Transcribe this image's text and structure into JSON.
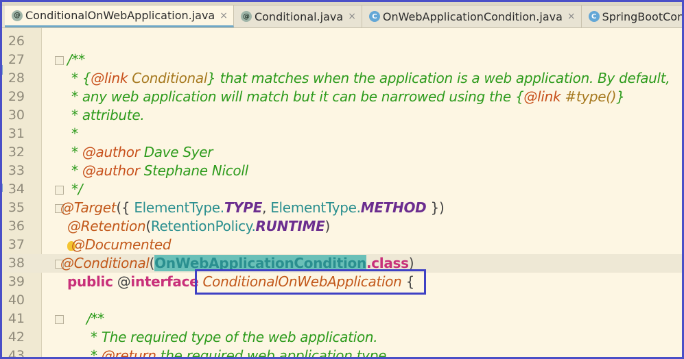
{
  "tabs": [
    {
      "label": "ConditionalOnWebApplication.java",
      "icon": "annotation-icon",
      "glyph": "@",
      "active": true
    },
    {
      "label": "Conditional.java",
      "icon": "annotation-icon",
      "glyph": "@",
      "active": false
    },
    {
      "label": "OnWebApplicationCondition.java",
      "icon": "class-icon",
      "glyph": "C",
      "active": false
    },
    {
      "label": "SpringBootCondition.jav",
      "icon": "class-icon",
      "glyph": "C",
      "active": false
    }
  ],
  "close_glyph": "×",
  "lines": [
    {
      "n": "26",
      "tokens": []
    },
    {
      "n": "27",
      "tokens": [
        [
          "c-comment",
          "/**"
        ]
      ],
      "indent": 98,
      "fold": true
    },
    {
      "n": "28",
      "tokens": [
        [
          "c-comment",
          " * {"
        ],
        [
          "c-tag",
          "@link"
        ],
        [
          "c-comment",
          " "
        ],
        [
          "c-link",
          "Conditional"
        ],
        [
          "c-comment",
          "} that matches when the application is a web application. By default,"
        ]
      ],
      "indent": 98
    },
    {
      "n": "29",
      "tokens": [
        [
          "c-comment",
          " * any web application will match but it can be narrowed using the {"
        ],
        [
          "c-tag",
          "@link"
        ],
        [
          "c-comment",
          " "
        ],
        [
          "c-link",
          "#type()"
        ],
        [
          "c-comment",
          "}"
        ]
      ],
      "indent": 98
    },
    {
      "n": "30",
      "tokens": [
        [
          "c-comment",
          " * attribute."
        ]
      ],
      "indent": 98
    },
    {
      "n": "31",
      "tokens": [
        [
          "c-comment",
          " *"
        ]
      ],
      "indent": 98
    },
    {
      "n": "32",
      "tokens": [
        [
          "c-comment",
          " * "
        ],
        [
          "c-tag",
          "@author"
        ],
        [
          "c-comment",
          " Dave Syer"
        ]
      ],
      "indent": 98
    },
    {
      "n": "33",
      "tokens": [
        [
          "c-comment",
          " * "
        ],
        [
          "c-tag",
          "@author"
        ],
        [
          "c-comment",
          " Stephane Nicoll"
        ]
      ],
      "indent": 98
    },
    {
      "n": "34",
      "tokens": [
        [
          "c-comment",
          " */"
        ]
      ],
      "indent": 98,
      "fold": true
    },
    {
      "n": "35",
      "tokens": [
        [
          "c-annot",
          "@Target"
        ],
        [
          "c-plain",
          "({ "
        ],
        [
          "c-type",
          "ElementType."
        ],
        [
          "c-const",
          "TYPE"
        ],
        [
          "c-plain",
          ", "
        ],
        [
          "c-type",
          "ElementType."
        ],
        [
          "c-const",
          "METHOD"
        ],
        [
          "c-plain",
          " })"
        ]
      ],
      "indent": 88,
      "fold": true
    },
    {
      "n": "36",
      "tokens": [
        [
          "c-annot",
          "@Retention"
        ],
        [
          "c-plain",
          "("
        ],
        [
          "c-type",
          "RetentionPolicy."
        ],
        [
          "c-const",
          "RUNTIME"
        ],
        [
          "c-plain",
          ")"
        ]
      ],
      "indent": 98
    },
    {
      "n": "37",
      "tokens": [
        [
          "c-annot",
          "@Documented"
        ]
      ],
      "indent": 98,
      "bulb": true
    },
    {
      "n": "38",
      "tokens": [
        [
          "c-annot",
          "@Conditional"
        ],
        [
          "c-plain",
          "("
        ],
        [
          "c-hl",
          "OnWebApplicationCondition"
        ],
        [
          "c-kw-class",
          ".class"
        ],
        [
          "c-plain",
          ")"
        ]
      ],
      "indent": 88,
      "current": true,
      "fold": true
    },
    {
      "n": "39",
      "tokens": [
        [
          "c-kw",
          "public"
        ],
        [
          "c-plain",
          " @"
        ],
        [
          "c-kw",
          "interface"
        ],
        [
          "c-plain",
          " "
        ],
        [
          "c-classname",
          "ConditionalOnWebApplication"
        ],
        [
          "c-plain",
          " {"
        ]
      ],
      "indent": 98
    },
    {
      "n": "40",
      "tokens": []
    },
    {
      "n": "41",
      "tokens": [
        [
          "c-comment",
          "/**"
        ]
      ],
      "indent": 126,
      "fold": true
    },
    {
      "n": "42",
      "tokens": [
        [
          "c-comment",
          " * The required type of the web application."
        ]
      ],
      "indent": 126
    },
    {
      "n": "43",
      "tokens": [
        [
          "c-comment",
          " * "
        ],
        [
          "c-tag",
          "@return"
        ],
        [
          "c-comment",
          " the required web application type"
        ]
      ],
      "indent": 126
    }
  ]
}
